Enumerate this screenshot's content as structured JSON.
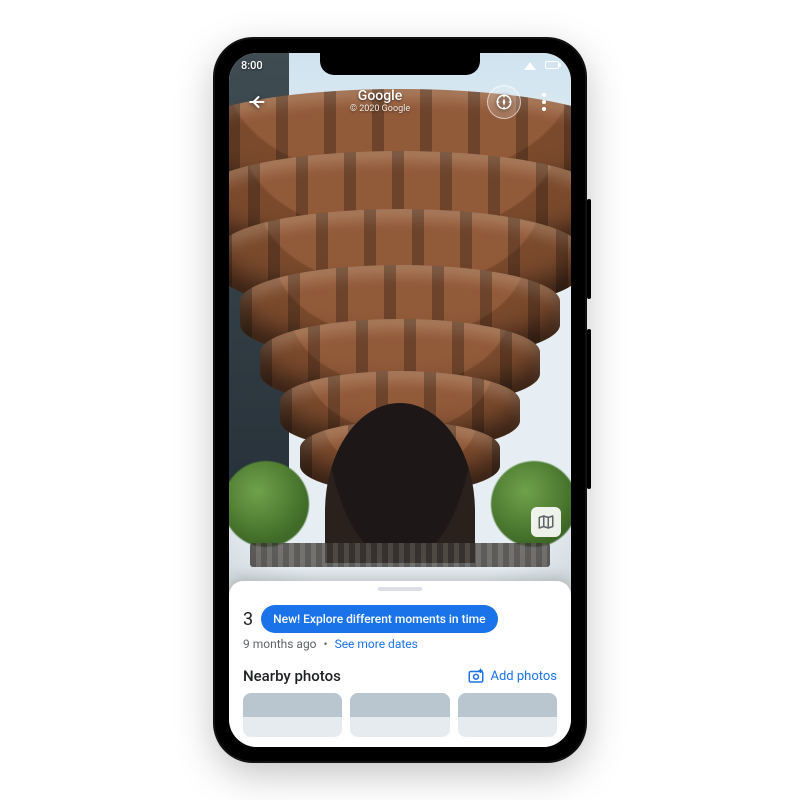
{
  "status_bar": {
    "time": "8:00"
  },
  "header": {
    "title": "Google",
    "subtitle": "© 2020 Google"
  },
  "callout": {
    "prefix_count": "3",
    "bubble_text": "New! Explore different moments in time"
  },
  "timeline": {
    "age_text": "9 months ago",
    "see_more_label": "See more dates"
  },
  "nearby": {
    "heading": "Nearby photos",
    "add_photos_label": "Add photos"
  },
  "colors": {
    "accent": "#1a73e8"
  }
}
